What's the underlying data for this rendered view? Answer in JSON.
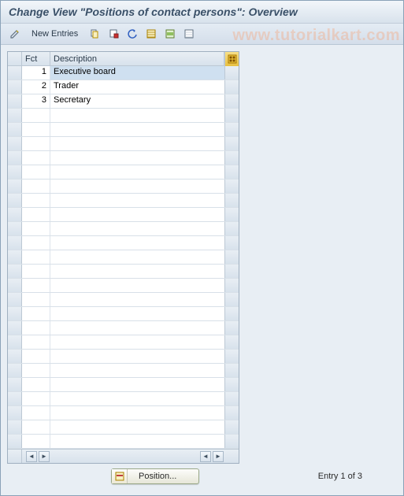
{
  "header": {
    "title": "Change View \"Positions of contact persons\": Overview"
  },
  "toolbar": {
    "new_entries_label": "New Entries",
    "icons": {
      "edit": "edit-icon",
      "copy": "copy-icon",
      "delete": "delete-icon",
      "undo": "undo-icon",
      "select_all": "select-all-icon",
      "select_block": "select-block-icon",
      "deselect_all": "deselect-all-icon"
    }
  },
  "watermark": "www.tutorialkart.com",
  "table": {
    "col_fct": "Fct",
    "col_desc": "Description",
    "rows": [
      {
        "fct": "1",
        "desc": "Executive board",
        "selected": true
      },
      {
        "fct": "2",
        "desc": "Trader",
        "selected": false
      },
      {
        "fct": "3",
        "desc": "Secretary",
        "selected": false
      }
    ],
    "empty_rows": 24
  },
  "footer": {
    "position_label": "Position...",
    "entry_status": "Entry 1 of 3"
  },
  "colors": {
    "accent_yellow": "#e8c040",
    "header_text": "#3a5068"
  }
}
